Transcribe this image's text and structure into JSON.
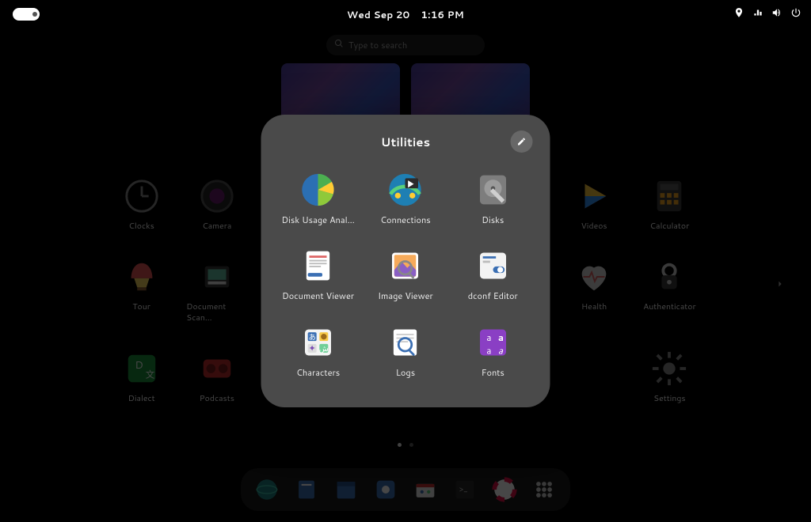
{
  "topbar": {
    "date": "Wed Sep 20",
    "time": "1:16 PM"
  },
  "search": {
    "placeholder": "Type to search"
  },
  "bg_apps": [
    {
      "label": "Clocks",
      "icon": "clock-icon"
    },
    {
      "label": "Camera",
      "icon": "camera-icon"
    },
    {
      "label": "",
      "icon": "",
      "placeholder": true
    },
    {
      "label": "",
      "icon": "",
      "placeholder": true
    },
    {
      "label": "",
      "icon": "",
      "placeholder": true
    },
    {
      "label": "",
      "icon": "",
      "placeholder": true
    },
    {
      "label": "Videos",
      "icon": "videos-icon"
    },
    {
      "label": "Calculator",
      "icon": "calculator-icon"
    },
    {
      "label": "Tour",
      "icon": "tour-icon"
    },
    {
      "label": "Document Scan…",
      "icon": "document-scanner-icon"
    },
    {
      "label": "",
      "icon": "",
      "placeholder": true
    },
    {
      "label": "",
      "icon": "",
      "placeholder": true
    },
    {
      "label": "",
      "icon": "",
      "placeholder": true
    },
    {
      "label": "",
      "icon": "",
      "placeholder": true
    },
    {
      "label": "Health",
      "icon": "health-icon"
    },
    {
      "label": "Authenticator",
      "icon": "authenticator-icon"
    },
    {
      "label": "Dialect",
      "icon": "dialect-icon"
    },
    {
      "label": "Podcasts",
      "icon": "podcasts-icon"
    },
    {
      "label": "",
      "icon": "",
      "placeholder": true
    },
    {
      "label": "",
      "icon": "",
      "placeholder": true
    },
    {
      "label": "",
      "icon": "",
      "placeholder": true
    },
    {
      "label": "",
      "icon": "",
      "placeholder": true
    },
    {
      "label": "",
      "icon": "",
      "placeholder": true
    },
    {
      "label": "Settings",
      "icon": "settings-icon"
    }
  ],
  "folder": {
    "title": "Utilities",
    "apps": [
      {
        "label": "Disk Usage Anal…",
        "icon": "disk-usage-analyzer-icon"
      },
      {
        "label": "Connections",
        "icon": "connections-icon"
      },
      {
        "label": "Disks",
        "icon": "disks-icon"
      },
      {
        "label": "Document Viewer",
        "icon": "document-viewer-icon"
      },
      {
        "label": "Image Viewer",
        "icon": "image-viewer-icon"
      },
      {
        "label": "dconf Editor",
        "icon": "dconf-editor-icon"
      },
      {
        "label": "Characters",
        "icon": "characters-icon"
      },
      {
        "label": "Logs",
        "icon": "logs-icon"
      },
      {
        "label": "Fonts",
        "icon": "fonts-icon"
      }
    ]
  },
  "dash": [
    {
      "name": "web-browser-icon"
    },
    {
      "name": "files-icon"
    },
    {
      "name": "calendar-icon"
    },
    {
      "name": "software-icon"
    },
    {
      "name": "software-center-icon"
    },
    {
      "name": "terminal-icon"
    },
    {
      "name": "help-icon"
    },
    {
      "name": "app-grid-icon"
    }
  ]
}
